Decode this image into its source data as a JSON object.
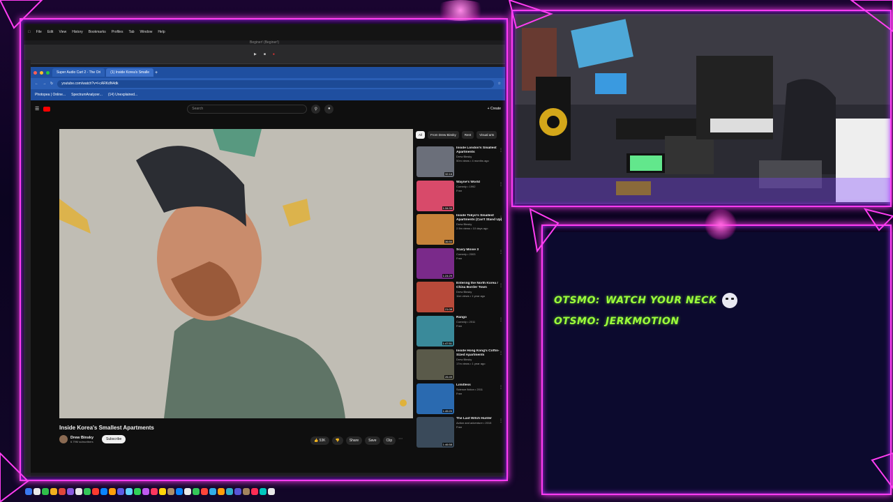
{
  "menubar": {
    "items": [
      "File",
      "Edit",
      "View",
      "History",
      "Bookmarks",
      "Profiles",
      "Tab",
      "Window",
      "Help"
    ]
  },
  "daw": {
    "title": "Beginer! (Beginer!)"
  },
  "browser": {
    "tabs": [
      "Super Audio Cart 2 - The Ori",
      "(1) Inside Korea's Smalle"
    ],
    "url": "youtube.com/watch?v=l-cARKdN4dk",
    "bookmarks": [
      "Photopea | Online...",
      "SpectrumAnalyzer...",
      "(14) Unexplained..."
    ]
  },
  "youtube": {
    "search_placeholder": "Search",
    "create_label": "Create",
    "video_title": "Inside Korea's Smallest Apartments",
    "channel_name": "Drew Binsky",
    "channel_subs": "6.79M subscribers",
    "subscribe_label": "Subscribe",
    "like_count": "53K",
    "share_label": "Share",
    "save_label": "Save",
    "clip_label": "Clip",
    "chips": [
      "All",
      "From Drew Binsky",
      "Rent",
      "Visual arts"
    ],
    "recommendations": [
      {
        "title": "Inside London's Smallest Apartments",
        "meta1": "Drew Binsky",
        "meta2": "50m views • 4 months ago",
        "duration": "32:16",
        "color": "#6b6f7a"
      },
      {
        "title": "Wayne's World",
        "meta1": "Comedy • 1992",
        "meta2": "Free",
        "duration": "1:34:33",
        "color": "#d84a6a"
      },
      {
        "title": "Inside Tokyo's Smallest Apartments (Can't Stand Up)",
        "meta1": "Drew Binsky",
        "meta2": "2.5m views • 10 days ago",
        "duration": "36:50",
        "color": "#c6833a"
      },
      {
        "title": "Scary Movie 3",
        "meta1": "Comedy • 2003",
        "meta2": "Free",
        "duration": "1:24:29",
        "color": "#7a2a8a"
      },
      {
        "title": "Entering the North Korea / China Border Town",
        "meta1": "Drew Binsky",
        "meta2": "11m views • 1 year ago",
        "duration": "21:08",
        "color": "#b84a3a"
      },
      {
        "title": "Rango",
        "meta1": "Comedy • 2011",
        "meta2": "Free",
        "duration": "1:47:51",
        "color": "#3a8a9a"
      },
      {
        "title": "Inside Hong Kong's Coffin-Sized Apartments",
        "meta1": "Drew Binsky",
        "meta2": "17m views • 1 year ago",
        "duration": "26:49",
        "color": "#5a5a4a"
      },
      {
        "title": "Limitless",
        "meta1": "Science fiction • 2011",
        "meta2": "Free",
        "duration": "1:45:20",
        "color": "#2a6ab0"
      },
      {
        "title": "The Last Witch Hunter",
        "meta1": "Action and adventure • 2015",
        "meta2": "Free",
        "duration": "1:46:58",
        "color": "#3a4a5a"
      }
    ]
  },
  "chat": {
    "messages": [
      {
        "user": "OTSMO:",
        "text": "WATCH YOUR NECK"
      },
      {
        "user": "OTSMO:",
        "text": "JERKMOTION"
      }
    ]
  },
  "colors": {
    "neon": "#ff3df2",
    "chat_text": "#9dff3a",
    "chat_bg": "#0c0a2e",
    "youtube_red": "#ff0000"
  }
}
